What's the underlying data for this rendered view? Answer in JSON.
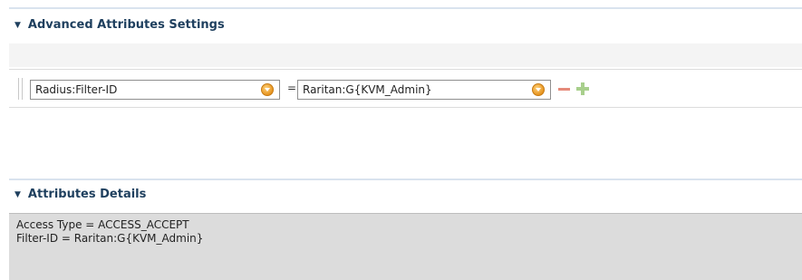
{
  "advanced_section": {
    "title": "Advanced Attributes Settings",
    "attribute_row": {
      "left_select_value": "Radius:Filter-ID",
      "operator": "=",
      "right_select_value": "Raritan:G{KVM_Admin}"
    }
  },
  "details_section": {
    "title": "Attributes Details",
    "lines": [
      "Access Type = ACCESS_ACCEPT",
      "Filter-ID = Raritan:G{KVM_Admin}"
    ]
  },
  "colors": {
    "header_text": "#1e3f5e",
    "remove_icon": "#e58a7a",
    "add_icon": "#a8cf8c",
    "dropdown_icon": "#e69420",
    "details_background": "#dcdcdc"
  },
  "icons": {
    "collapse": "triangle-down-icon",
    "dropdown": "dropdown-circle-icon",
    "remove": "minus-icon",
    "add": "plus-icon",
    "drag": "drag-handle-icon"
  }
}
